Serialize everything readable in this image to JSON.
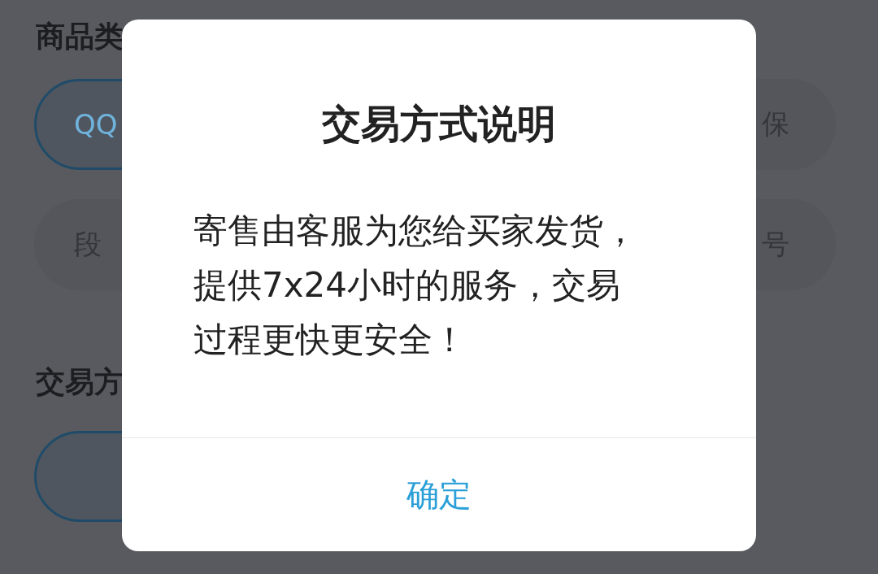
{
  "background": {
    "sections": [
      {
        "heading": "商品类",
        "chips": [
          {
            "label": "QQ",
            "selected": true
          },
          {
            "label": "保",
            "selected": false
          },
          {
            "label": "段",
            "selected": false
          },
          {
            "label": "号",
            "selected": false
          }
        ]
      },
      {
        "heading": "交易方",
        "chips": [
          {
            "selected": true
          }
        ]
      }
    ]
  },
  "dialog": {
    "title": "交易方式说明",
    "message": "寄售由客服为您给买家发货，提供7x24小时的服务，交易过程更快更安全！",
    "confirm": "确定"
  }
}
